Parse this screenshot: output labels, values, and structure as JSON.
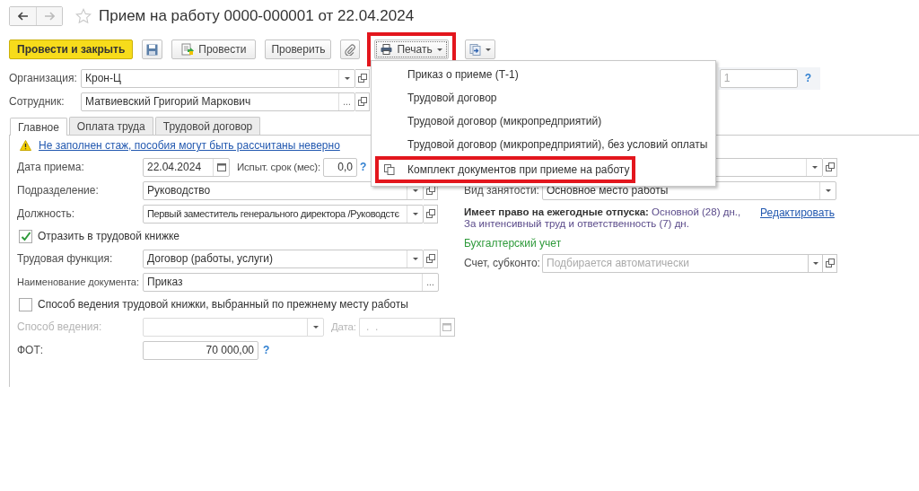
{
  "title": "Прием на работу 0000-000001 от 22.04.2024",
  "favorite": false,
  "toolbar": {
    "post_close": "Провести и закрыть",
    "post": "Провести",
    "check": "Проверить",
    "print": {
      "label": "Печать",
      "highlighted": true
    }
  },
  "organization": {
    "label": "Организация:",
    "value": "Крон-Ц"
  },
  "employee": {
    "label": "Сотрудник:",
    "value": "Матвиевский Григорий Маркович",
    "select_button": "..."
  },
  "side_field": {
    "value": "1",
    "help": "?"
  },
  "tabs": [
    {
      "label": "Главное",
      "selected": true
    },
    {
      "label": "Оплата труда",
      "selected": false
    },
    {
      "label": "Трудовой договор",
      "selected": false
    }
  ],
  "warning": "Не заполнен стаж, пособия могут быть рассчитаны неверно",
  "hire_date": {
    "label": "Дата приема:",
    "value": "22.04.2024"
  },
  "probation": {
    "label": "Испыт. срок (мес):",
    "value": "0,0",
    "help": "?"
  },
  "department": {
    "label": "Подразделение:",
    "value": "Руководство"
  },
  "position": {
    "label": "Должность:",
    "value": "Первый заместитель генерального директора /Руководстє"
  },
  "reflect_in_book": {
    "label": "Отразить в трудовой книжке",
    "checked": true
  },
  "labor_function": {
    "label": "Трудовая функция:",
    "value": "Договор (работы, услуги)"
  },
  "document_name": {
    "label": "Наименование документа:",
    "value": "Приказ",
    "select_button": "..."
  },
  "previous_method": {
    "label": "Способ ведения трудовой книжки, выбранный по прежнему месту работы",
    "checked": false
  },
  "method": {
    "label": "Способ ведения:",
    "disabled": true
  },
  "method_date": {
    "label": "Дата:",
    "placeholder": " .  .",
    "disabled": true
  },
  "payroll": {
    "label": "ФОТ:",
    "value": "70 000,00",
    "help": "?"
  },
  "employment_type": {
    "label": "Вид занятости:",
    "value": "Основное место работы"
  },
  "vacation": {
    "label": "Имеет право на ежегодные отпуска:",
    "value": "Основной (28) дн., За интенсивный труд и ответственность (7) дн.",
    "link": "Редактировать"
  },
  "accounting": {
    "heading": "Бухгалтерский учет",
    "label": "Счет, субконто:",
    "placeholder": "Подбирается автоматически"
  },
  "print_menu": {
    "items": [
      {
        "label": "Приказ о приеме (Т-1)",
        "kind": "plain",
        "highlighted": false
      },
      {
        "label": "Трудовой договор",
        "kind": "plain",
        "highlighted": false
      },
      {
        "label": "Трудовой договор (микропредприятий)",
        "kind": "plain",
        "highlighted": false
      },
      {
        "label": "Трудовой договор (микропредприятий), без условий оплаты",
        "kind": "plain",
        "highlighted": false
      },
      {
        "label": "Комплект документов при приеме на работу",
        "kind": "set",
        "highlighted": true
      }
    ]
  }
}
